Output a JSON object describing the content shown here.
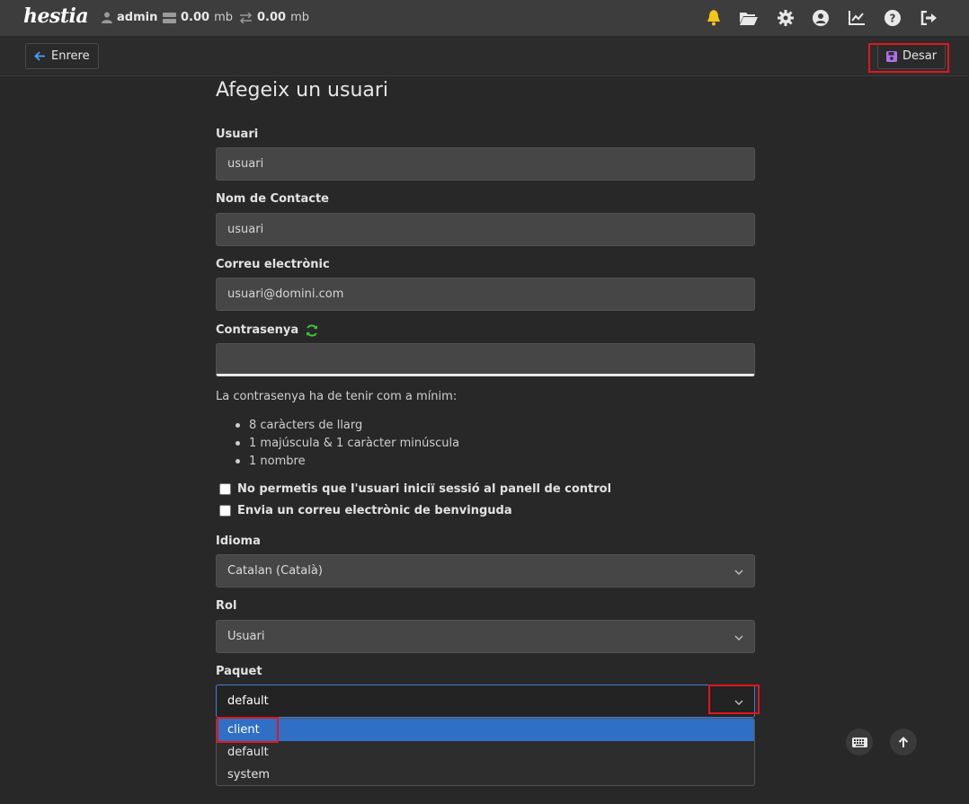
{
  "app": {
    "logo_text": "hestia"
  },
  "topbar": {
    "user": "admin",
    "disk_value": "0.00",
    "disk_unit": "mb",
    "bandwidth_value": "0.00",
    "bandwidth_unit": "mb",
    "icons": [
      "bell-icon",
      "folder-icon",
      "gear-icon",
      "user-circle-icon",
      "chart-icon",
      "help-icon",
      "logout-icon"
    ]
  },
  "toolbar": {
    "back_label": "Enrere",
    "save_label": "Desar"
  },
  "form": {
    "title": "Afegeix un usuari",
    "username_label": "Usuari",
    "username_value": "usuari",
    "contact_label": "Nom de Contacte",
    "contact_value": "usuari",
    "email_label": "Correu electrònic",
    "email_value": "usuari@domini.com",
    "password_label": "Contrasenya",
    "password_value": "",
    "password_hint": "La contrasenya ha de tenir com a mínim:",
    "password_rules": [
      "8 caràcters de llarg",
      "1 majúscula & 1 caràcter minúscula",
      "1 nombre"
    ],
    "checkbox_login_label": "No permetis que l'usuari iniciï sessió al panell de control",
    "checkbox_email_label": "Envia un correu electrònic de benvinguda",
    "language_label": "Idioma",
    "language_value": "Catalan (Català)",
    "role_label": "Rol",
    "role_value": "Usuari",
    "package_label": "Paquet",
    "package_value": "default",
    "package_options": [
      "client",
      "default",
      "system"
    ]
  },
  "colors": {
    "accent_blue": "#2f6fc6",
    "refresh_green": "#3cc63c",
    "bell_yellow": "#f5c518",
    "save_icon_purple": "#b06de8",
    "highlight_red": "#e3151c"
  }
}
